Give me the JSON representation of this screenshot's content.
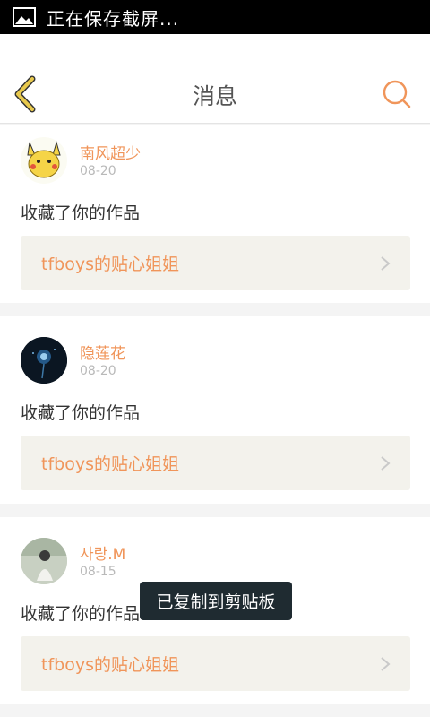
{
  "status_bar": {
    "text": "正在保存截屏...",
    "icon": "image-icon"
  },
  "header": {
    "title": "消息",
    "back_icon": "back-chevron-icon",
    "search_icon": "search-icon",
    "accent": "#f0955a",
    "back_color": "#e8c94d"
  },
  "messages": [
    {
      "name": "南风超少",
      "date": "08-20",
      "action": "收藏了你的作品",
      "work": "tfboys的贴心姐姐",
      "avatar": "pikachu-avatar"
    },
    {
      "name": "隐莲花",
      "date": "08-20",
      "action": "收藏了你的作品",
      "work": "tfboys的贴心姐姐",
      "avatar": "dark-flower-avatar"
    },
    {
      "name": "사랑.M",
      "date": "08-15",
      "action": "收藏了你的作品",
      "work": "tfboys的贴心姐姐",
      "avatar": "girl-photo-avatar"
    }
  ],
  "toast": {
    "text": "已复制到剪贴板"
  }
}
